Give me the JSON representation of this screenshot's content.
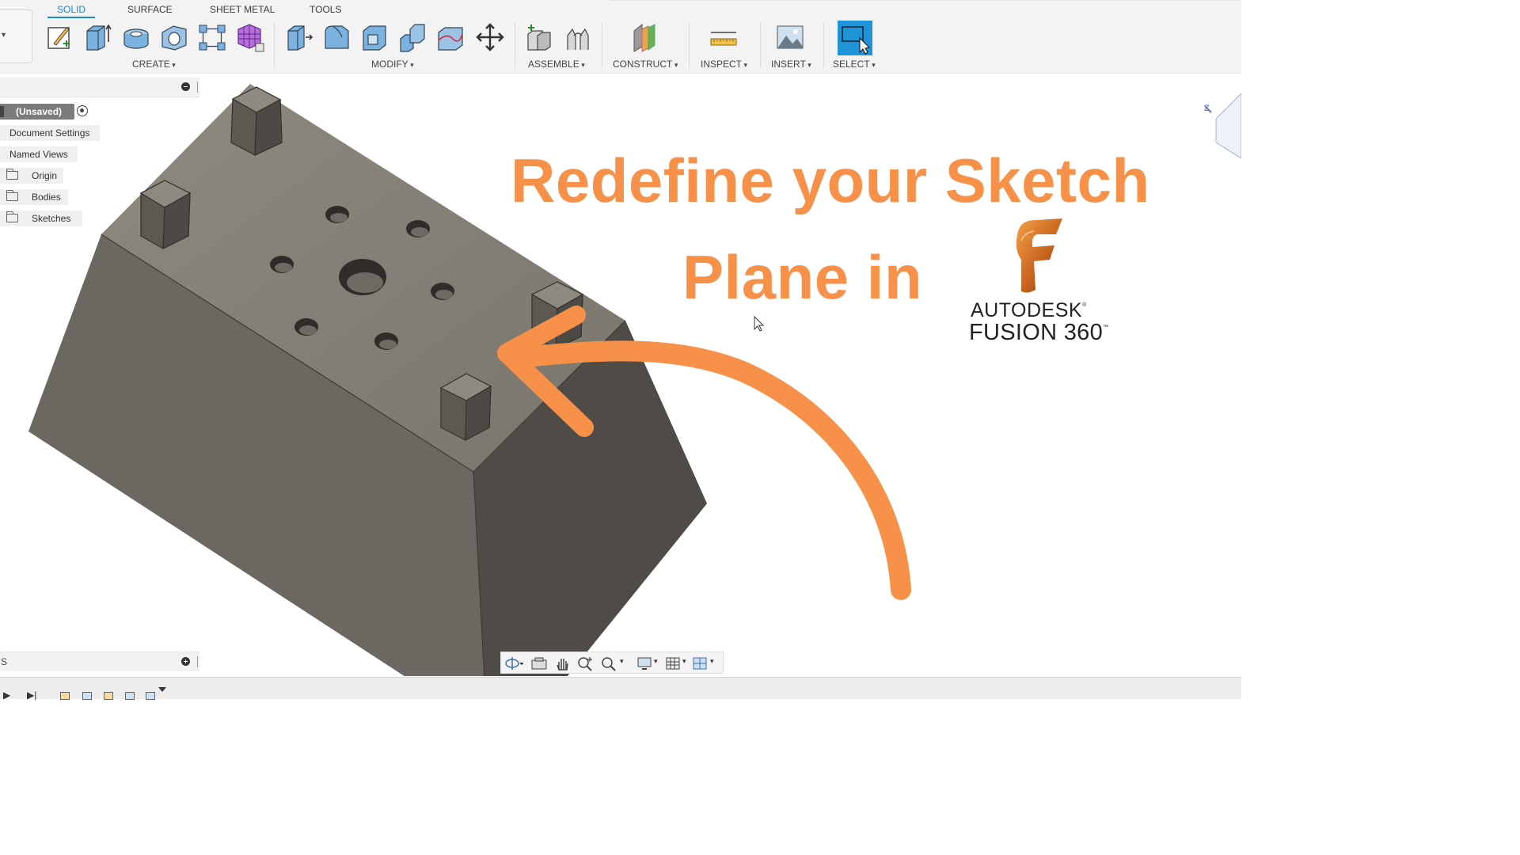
{
  "toolbar": {
    "tabs": [
      {
        "label": "SOLID",
        "active": true
      },
      {
        "label": "SURFACE",
        "active": false
      },
      {
        "label": "SHEET METAL",
        "active": false
      },
      {
        "label": "TOOLS",
        "active": false
      }
    ],
    "groups": {
      "create": "CREATE",
      "modify": "MODIFY",
      "assemble": "ASSEMBLE",
      "construct": "CONSTRUCT",
      "inspect": "INSPECT",
      "insert": "INSERT",
      "select": "SELECT"
    },
    "accent_color": "#1a8ad8"
  },
  "browser": {
    "header_label": "",
    "root": "(Unsaved)",
    "items": [
      {
        "label": "Document Settings"
      },
      {
        "label": "Named Views"
      },
      {
        "label": "Origin"
      },
      {
        "label": "Bodies"
      },
      {
        "label": "Sketches"
      }
    ]
  },
  "comments_panel": {
    "label": "S"
  },
  "overlay": {
    "title_line_1": "Redefine your Sketch",
    "title_line_2": "Plane in",
    "title_color": "#f7914a",
    "brand_line_1": "AUTODESK",
    "brand_line_2": "FUSION 360",
    "brand_mark_1": "®",
    "brand_mark_2": "™"
  },
  "icons": {
    "create": [
      "sketch-icon",
      "extrude-icon",
      "revolve-icon",
      "hole-icon",
      "pattern-icon",
      "form-icon"
    ],
    "modify": [
      "press-pull-icon",
      "fillet-icon",
      "shell-icon",
      "combine-icon",
      "replace-face-icon",
      "move-icon"
    ],
    "assemble": [
      "new-component-icon",
      "joint-icon"
    ],
    "construct": [
      "plane-icon"
    ],
    "inspect": [
      "measure-icon"
    ],
    "insert": [
      "insert-image-icon"
    ],
    "select": [
      "select-icon"
    ],
    "navigation": [
      "orbit-icon",
      "look-at-icon",
      "pan-icon",
      "zoom-icon",
      "fit-icon",
      "display-settings-icon",
      "grid-icon",
      "viewports-icon"
    ]
  }
}
